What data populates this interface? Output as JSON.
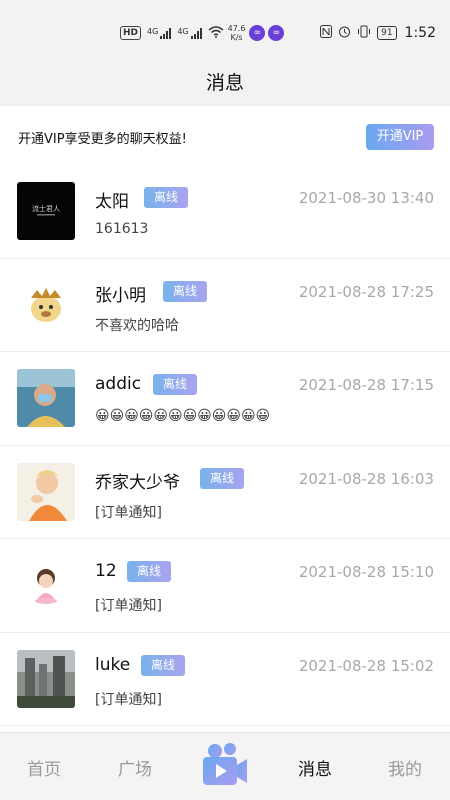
{
  "status_bar": {
    "hd": "HD",
    "sig1_label": "4G",
    "sig2_label": "4G",
    "speed_value": "47.6",
    "speed_unit": "K/s",
    "battery": "91",
    "time": "1:52"
  },
  "header": {
    "title": "消息"
  },
  "vip": {
    "text": "开通VIP享受更多的聊天权益!",
    "button": "开通VIP"
  },
  "chats": [
    {
      "name": "太阳",
      "status": "离线",
      "time": "2021-08-30 13:40",
      "preview": "161613",
      "avatar_text": "流士君人"
    },
    {
      "name": "张小明",
      "status": "离线",
      "time": "2021-08-28 17:25",
      "preview": "不喜欢的哈哈"
    },
    {
      "name": "addic",
      "status": "离线",
      "time": "2021-08-28 17:15",
      "preview": "😀😀😀😀😀😀😀😀😀😀😀😀"
    },
    {
      "name": "乔家大少爷",
      "status": "离线",
      "time": "2021-08-28 16:03",
      "preview": "[订单通知]"
    },
    {
      "name": "12",
      "status": "离线",
      "time": "2021-08-28 15:10",
      "preview": "[订单通知]"
    },
    {
      "name": "luke",
      "status": "离线",
      "time": "2021-08-28 15:02",
      "preview": "[订单通知]"
    }
  ],
  "bottom_nav": {
    "home": "首页",
    "square": "广场",
    "messages": "消息",
    "mine": "我的",
    "center_icon": "video-camera-icon",
    "active": "messages"
  },
  "colors": {
    "badge_start": "#79b2ec",
    "badge_end": "#a9a4ef",
    "timestamp": "#a8a8a8",
    "nav_inactive": "#999999",
    "nav_active": "#111111"
  }
}
